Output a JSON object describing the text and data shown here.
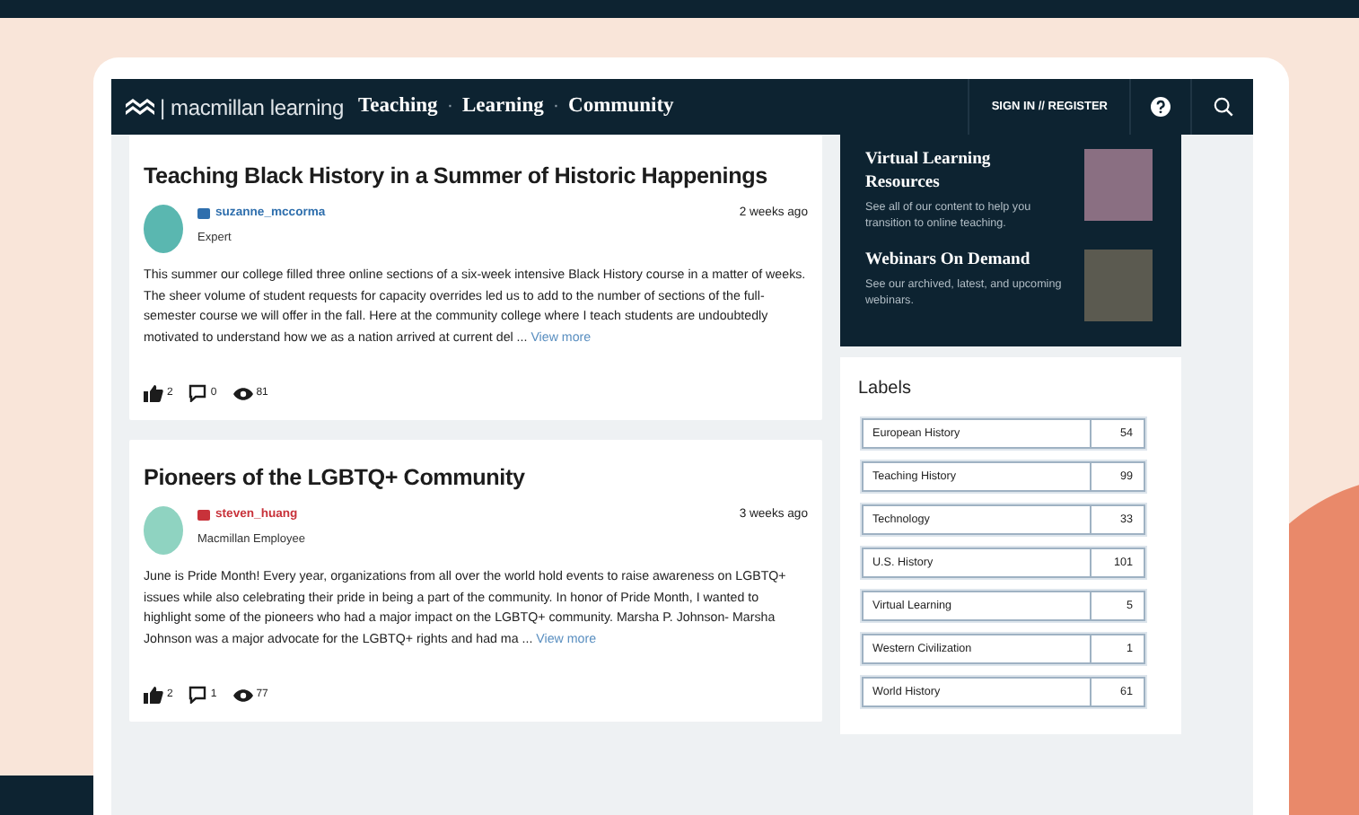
{
  "header": {
    "logo_text": "| macmillan learning",
    "nav": [
      {
        "label": "Teaching"
      },
      {
        "label": "Learning"
      },
      {
        "label": "Community"
      }
    ],
    "separator": "·",
    "sign_in": "SIGN IN // REGISTER"
  },
  "posts": [
    {
      "title": "Teaching Black History in a Summer of Historic Happenings",
      "author": "suzanne_mccorma",
      "color": "#2f6fad",
      "role": "Expert",
      "time": "2 weeks ago",
      "body": "This summer our college filled three online sections of a six-week intensive Black History course in a matter of weeks. The sheer volume of student requests for capacity overrides led us to add to the number of sections of the full-semester course we will offer in the fall. Here at the community college where I teach students are undoubtedly motivated to understand how we as a nation arrived at current del ...",
      "more": "View more",
      "likes": "2",
      "comments": "0",
      "views": "81"
    },
    {
      "title": "Pioneers of the LGBTQ+ Community",
      "author": "steven_huang",
      "color": "#c8323a",
      "role": "Macmillan Employee",
      "time": "3 weeks ago",
      "body": "June is Pride Month! Every year, organizations from all over the world hold events to raise awareness on LGBTQ+ issues while also celebrating their pride in being a part of the community. In honor of Pride Month, I wanted to highlight some of the pioneers who had a major impact on the LGBTQ+ community. Marsha P. Johnson- Marsha Johnson was a major advocate for the LGBTQ+ rights and had ma ...",
      "more": "View more",
      "likes": "2",
      "comments": "1",
      "views": "77"
    }
  ],
  "promos": [
    {
      "title": "Virtual Learning Resources",
      "text": "See all of our content to help you transition to online teaching."
    },
    {
      "title": "Webinars On Demand",
      "text": "See our archived, latest, and upcoming webinars."
    }
  ],
  "labels": {
    "title": "Labels",
    "items": [
      {
        "name": "European History",
        "count": "54"
      },
      {
        "name": "Teaching History",
        "count": "99"
      },
      {
        "name": "Technology",
        "count": "33"
      },
      {
        "name": "U.S. History",
        "count": "101"
      },
      {
        "name": "Virtual Learning",
        "count": "5"
      },
      {
        "name": "Western Civilization",
        "count": "1"
      },
      {
        "name": "World History",
        "count": "61"
      }
    ]
  }
}
